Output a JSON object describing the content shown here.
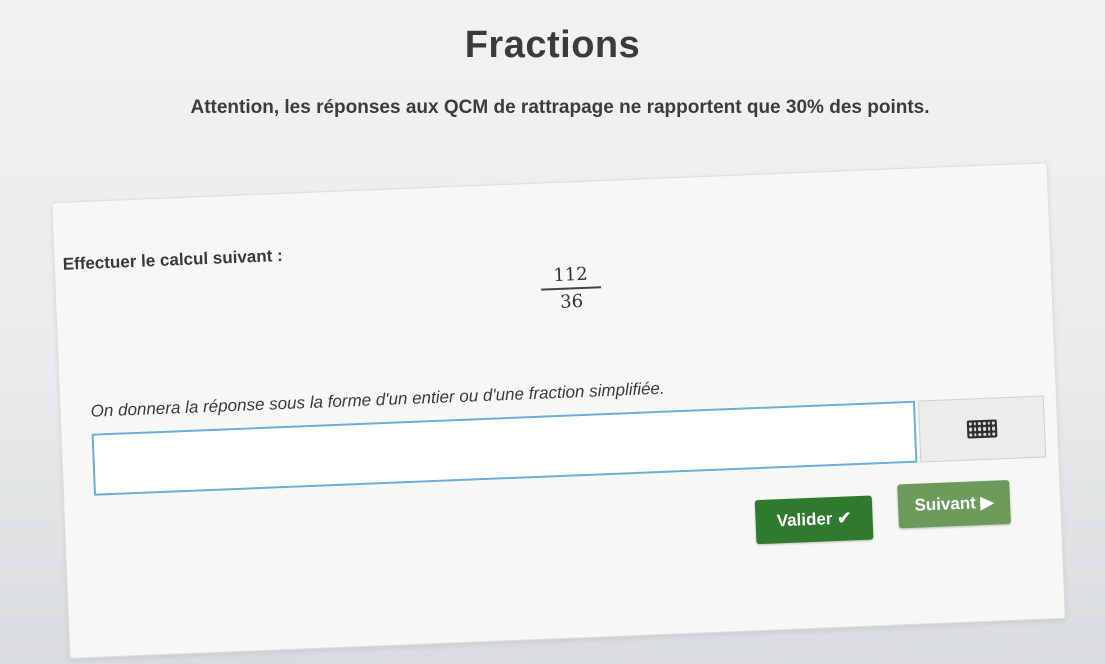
{
  "header": {
    "title": "Fractions",
    "warning": "Attention, les réponses aux QCM de rattrapage ne rapportent que 30% des points."
  },
  "exercise": {
    "instruction": "Effectuer le calcul suivant :",
    "fraction": {
      "numerator": "112",
      "denominator": "36"
    },
    "hint": "On donnera la réponse sous la forme d'un entier ou d'une fraction simplifiée.",
    "answer": {
      "value": "",
      "placeholder": ""
    },
    "keyboard_icon": "keyboard-icon"
  },
  "actions": {
    "validate_label": "Valider ✔",
    "next_label": "Suivant ▶",
    "validate_color": "#2f7a2d",
    "next_color": "#6b9a5a"
  }
}
